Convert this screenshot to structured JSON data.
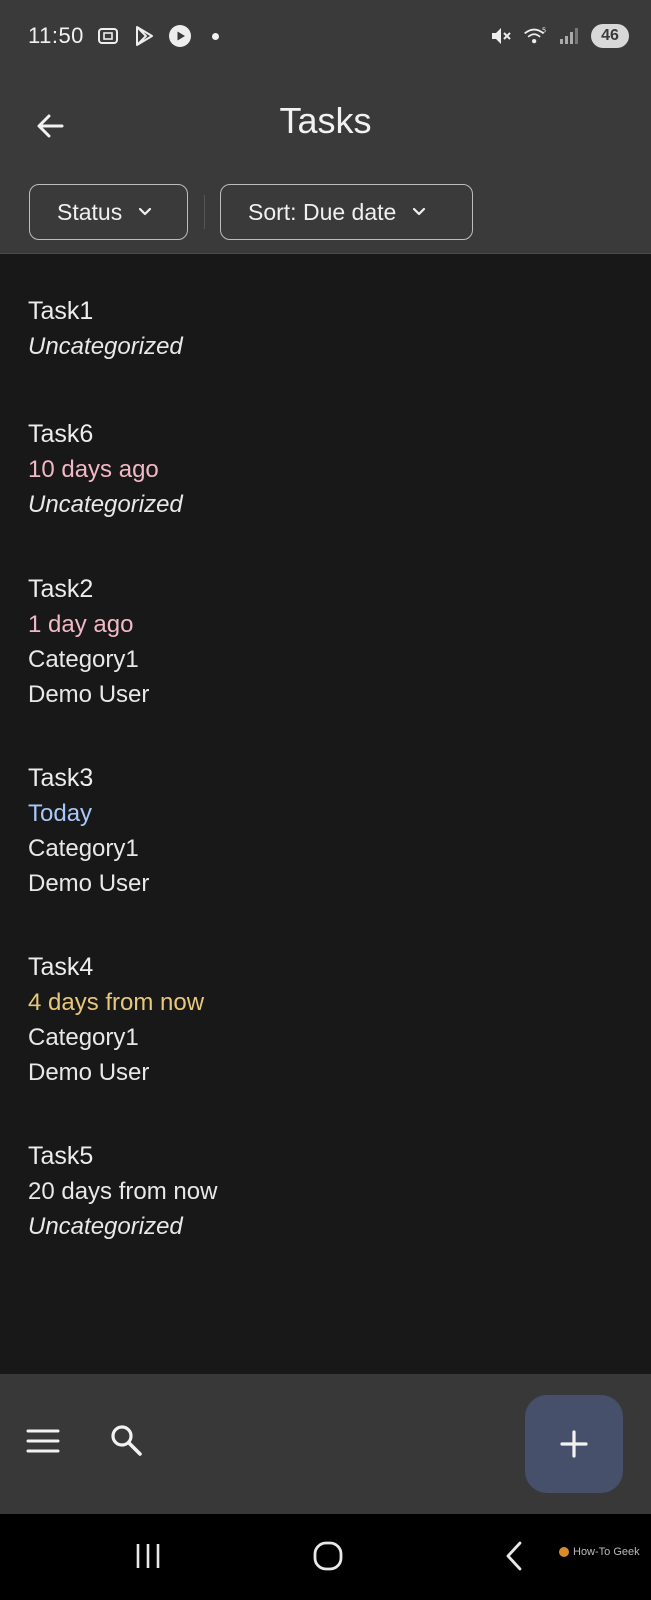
{
  "status_bar": {
    "time": "11:50",
    "battery": "46",
    "icons": [
      "screenshot-icon",
      "play-store-icon",
      "youtube-icon",
      "notification-dot",
      "mute-icon",
      "wifi-icon",
      "signal-icon",
      "battery-icon"
    ]
  },
  "app_bar": {
    "title": "Tasks",
    "back_icon": "arrow-left-icon"
  },
  "filters": {
    "status_label": "Status",
    "sort_label": "Sort: Due date"
  },
  "tasks": [
    {
      "title": "Task1",
      "due": "",
      "due_color": "",
      "category": "Uncategorized",
      "category_italic": true,
      "assignee": ""
    },
    {
      "title": "Task6",
      "due": "10 days ago",
      "due_color": "#f2b8c6",
      "category": "Uncategorized",
      "category_italic": true,
      "assignee": ""
    },
    {
      "title": "Task2",
      "due": "1 day ago",
      "due_color": "#f2b8c6",
      "category": "Category1",
      "category_italic": false,
      "assignee": "Demo User"
    },
    {
      "title": "Task3",
      "due": "Today",
      "due_color": "#a8c7fa",
      "category": "Category1",
      "category_italic": false,
      "assignee": "Demo User"
    },
    {
      "title": "Task4",
      "due": "4 days from now",
      "due_color": "#e8c77a",
      "category": "Category1",
      "category_italic": false,
      "assignee": "Demo User"
    },
    {
      "title": "Task5",
      "due": "20 days from now",
      "due_color": "#e8e8e8",
      "category": "Uncategorized",
      "category_italic": true,
      "assignee": ""
    }
  ],
  "bottom_bar": {
    "menu_icon": "hamburger-menu-icon",
    "search_icon": "search-icon",
    "fab_icon": "plus-icon"
  },
  "nav_bar": {
    "recent_icon": "recent-apps-icon",
    "home_icon": "home-icon",
    "back_icon": "back-chevron-icon",
    "watermark": "How-To Geek"
  }
}
